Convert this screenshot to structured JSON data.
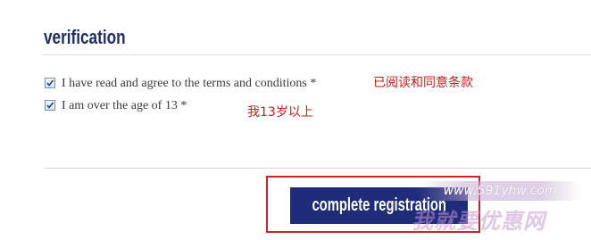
{
  "section": {
    "title": "verification"
  },
  "checkboxes": [
    {
      "label": "I have read and agree to the terms and conditions *",
      "checked": true,
      "annotation": "已阅读和同意条款"
    },
    {
      "label": "I am over the age of 13 *",
      "checked": true,
      "annotation": "我13岁以上"
    }
  ],
  "actions": {
    "complete_label": "complete registration"
  },
  "watermark": {
    "url": "www.591yhw.com",
    "text": "我就要优惠网"
  },
  "colors": {
    "title": "#1e2c6b",
    "button_bg": "#1f2c7a",
    "annotation": "#cc1b1b",
    "highlight_border": "#c8242a"
  }
}
